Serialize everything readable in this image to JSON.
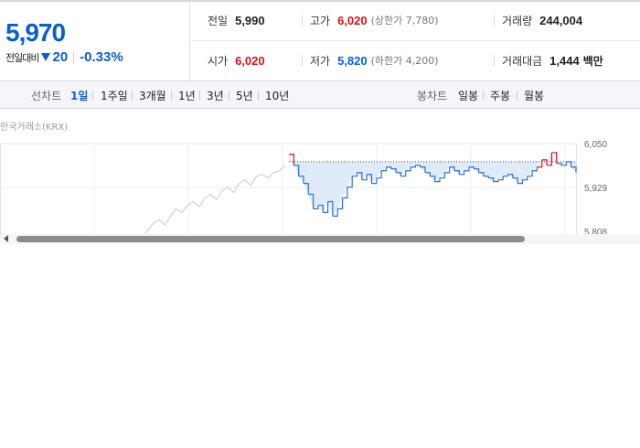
{
  "price": {
    "current": "5,970",
    "change_label": "전일대비",
    "change_amount": "20",
    "change_rate": "-0.33%"
  },
  "stats": {
    "prev_close": {
      "label": "전일",
      "value": "5,990"
    },
    "high": {
      "label": "고가",
      "value": "6,020",
      "sub": "(상한가 7,780)"
    },
    "volume": {
      "label": "거래량",
      "value": "244,004"
    },
    "open": {
      "label": "시가",
      "value": "6,020"
    },
    "low": {
      "label": "저가",
      "value": "5,820",
      "sub": "(하한가 4,200)"
    },
    "trade_value": {
      "label": "거래대금",
      "value": "1,444",
      "unit": "백만"
    }
  },
  "line_chart": {
    "label": "선차트",
    "tabs": [
      "1일",
      "1주일",
      "3개월",
      "1년",
      "3년",
      "5년",
      "10년"
    ],
    "active": "1일"
  },
  "candle_chart": {
    "label": "봉차트",
    "tabs": [
      "일봉",
      "주봉",
      "월봉"
    ]
  },
  "market": "한국거래소(KRX)",
  "colors": {
    "up": "#d6131d",
    "down": "#0b5ecf",
    "line": "#2f6fd0",
    "fill": "#dde9f8",
    "history": "#c8c8c8"
  },
  "chart_data": {
    "type": "line",
    "y_tick_labels": [
      "6,050",
      "5,929",
      "5,808"
    ],
    "ylim": [
      5808,
      6050
    ],
    "reference_line": 6000,
    "history_values": [
      5760,
      5780,
      5770,
      5800,
      5790,
      5810,
      5830,
      5840,
      5825,
      5850,
      5870,
      5860,
      5880,
      5890,
      5875,
      5900,
      5910,
      5895,
      5920,
      5930,
      5915,
      5940,
      5950,
      5935,
      5960,
      5965,
      5955,
      5970,
      5975,
      5990
    ],
    "intraday_values": [
      6020,
      5990,
      5960,
      5940,
      5910,
      5870,
      5880,
      5860,
      5890,
      5850,
      5870,
      5900,
      5930,
      5960,
      5970,
      5950,
      5965,
      5940,
      5955,
      5975,
      5985,
      5980,
      5970,
      5960,
      5975,
      5985,
      5990,
      5985,
      5970,
      5960,
      5945,
      5955,
      5970,
      5985,
      5975,
      5965,
      5975,
      5985,
      5980,
      5970,
      5960,
      5955,
      5945,
      5950,
      5960,
      5965,
      5955,
      5940,
      5950,
      5960,
      5975,
      5985,
      6005,
      5990,
      6025,
      5995,
      5990,
      6000,
      5985,
      5970
    ]
  }
}
